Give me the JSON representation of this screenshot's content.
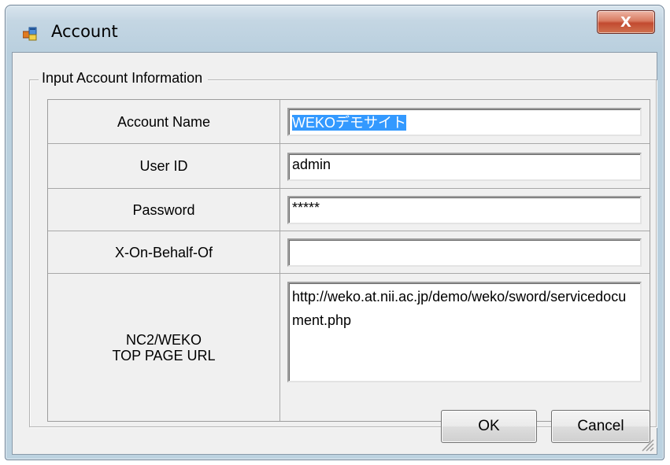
{
  "window": {
    "title": "Account",
    "close_label": "X"
  },
  "group": {
    "title": "Input Account Information"
  },
  "form": {
    "rows": [
      {
        "label": "Account Name",
        "value": "WEKOデモサイト"
      },
      {
        "label": "User ID",
        "value": "admin"
      },
      {
        "label": "Password",
        "value": "*****"
      },
      {
        "label": "X-On-Behalf-Of",
        "value": ""
      },
      {
        "label": "NC2/WEKO\nTOP PAGE URL",
        "value": "http://weko.at.nii.ac.jp/demo/weko/sword/servicedocument.php"
      }
    ]
  },
  "buttons": {
    "ok": "OK",
    "cancel": "Cancel"
  },
  "icons": {
    "app": "app-window-icon",
    "close": "close-icon",
    "resize": "resize-grip-icon"
  },
  "colors": {
    "selection": "#3399ff",
    "close_button": "#c24a30",
    "window_frame": "#bcd2e0",
    "client_bg": "#f0f0f0"
  }
}
